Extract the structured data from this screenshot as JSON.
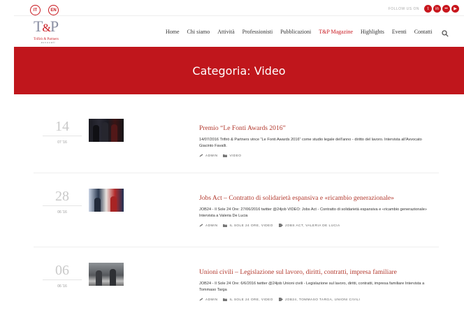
{
  "topbar": {
    "lang_it": "IT",
    "lang_en": "EN",
    "follow_label": "FOLLOW US ON",
    "social_icons": [
      "twitter-icon",
      "linkedin-icon",
      "flickr-icon",
      "youtube-icon"
    ]
  },
  "header": {
    "logo_mark": "T&P",
    "logo_name": "Trifirò & Partners",
    "logo_sub": "avvocati",
    "nav": [
      {
        "label": "Home"
      },
      {
        "label": "Chi siamo"
      },
      {
        "label": "Attività"
      },
      {
        "label": "Professionisti"
      },
      {
        "label": "Pubblicazioni"
      },
      {
        "label": "T&P Magazine"
      },
      {
        "label": "Highlights"
      },
      {
        "label": "Eventi"
      },
      {
        "label": "Contatti"
      }
    ]
  },
  "banner": {
    "title": "Categoria: Video"
  },
  "posts": [
    {
      "day": "14",
      "month": "07 '16",
      "title": "Premio “Le Fonti Awards 2016”",
      "excerpt": "14/07/2016 Trifirò & Partners vince “Le Fonti Awards 2016” come studio legale dell'anno - diritto del lavoro. Intervista all'Avvocato Giacinto Favalli.",
      "author": "ADMIN",
      "categories": "VIDEO",
      "tags": ""
    },
    {
      "day": "28",
      "month": "06 '16",
      "title": "Jobs Act – Contratto di solidarietà espansiva e «ricambio generazionale»",
      "excerpt": "JOB24 - Il Sole 24 Ore: 27/06/2016 twitter @24job VIDEO: Jobs Act - Contratto di solidarietà espansiva e «ricambio generazionale» Intervista a Valeria De Lucia",
      "author": "ADMIN",
      "categories": "IL SOLE 24 ORE, VIDEO",
      "tags": "JOBS ACT, VALERIA DE LUCIA"
    },
    {
      "day": "06",
      "month": "06 '16",
      "title": "Unioni civili – Legislazione sul lavoro, diritti, contratti, impresa familiare",
      "excerpt": "JOB24 - Il Sole 24 Ore: 6/6/2016 twitter @24job Unioni civili - Legislazione sul lavoro, diritti, contratti, impresa familiare Intervista a Tommaso Targa",
      "author": "ADMIN",
      "categories": "IL SOLE 24 ORE, VIDEO",
      "tags": "JOB24, TOMMASO TARGA, UNIONI CIVILI"
    }
  ],
  "colors": {
    "brand_red": "#c0161c",
    "title_red": "#b33a2f"
  }
}
